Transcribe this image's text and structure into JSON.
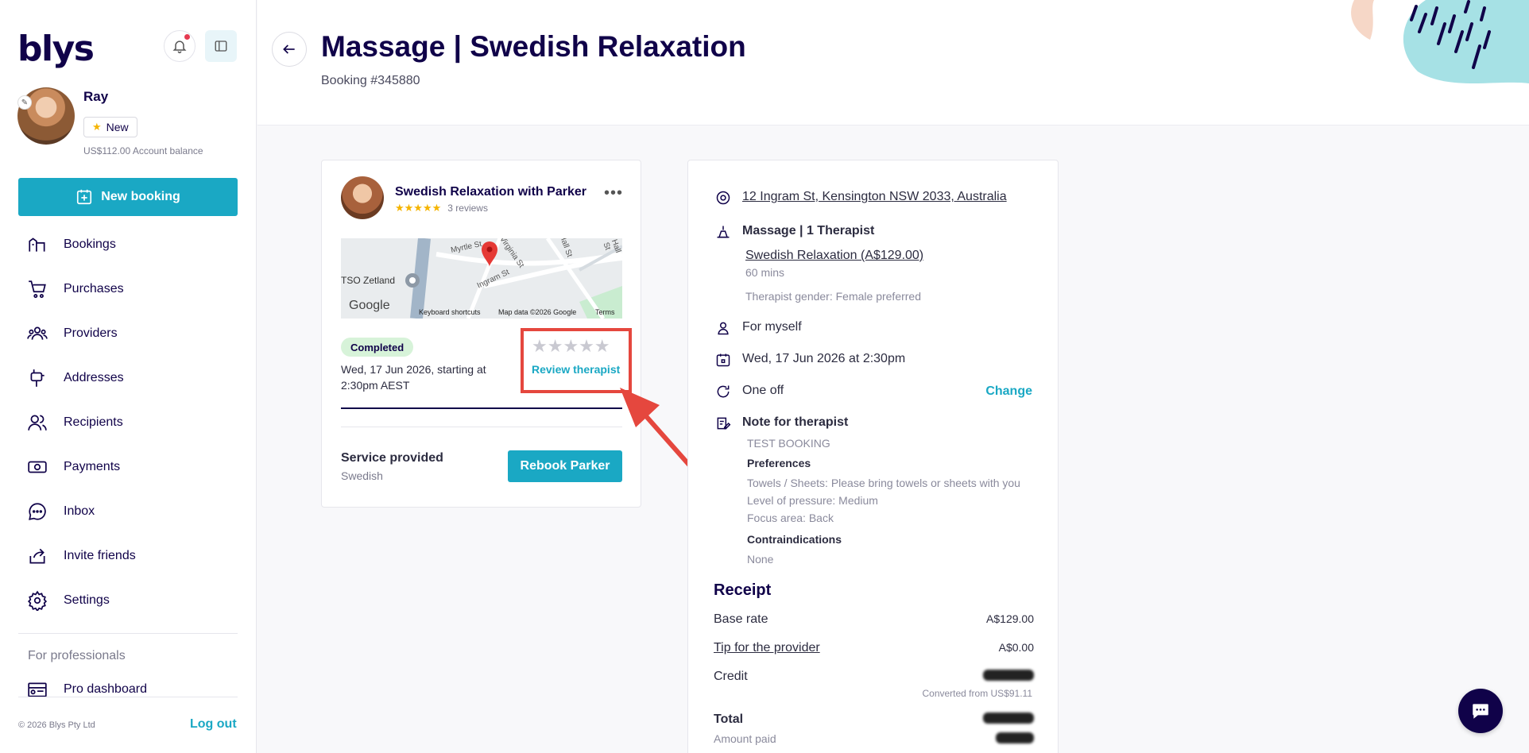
{
  "sidebar": {
    "logo": "blys",
    "user_name": "Ray",
    "badge": "New",
    "balance": "US$112.00 Account balance",
    "new_booking": "New booking",
    "nav": [
      {
        "label": "Bookings",
        "icon": "bookings-icon"
      },
      {
        "label": "Purchases",
        "icon": "cart-icon"
      },
      {
        "label": "Providers",
        "icon": "providers-icon"
      },
      {
        "label": "Addresses",
        "icon": "mailbox-icon"
      },
      {
        "label": "Recipients",
        "icon": "recipients-icon"
      },
      {
        "label": "Payments",
        "icon": "payments-icon"
      },
      {
        "label": "Inbox",
        "icon": "chat-bubble-icon"
      },
      {
        "label": "Invite friends",
        "icon": "share-icon"
      },
      {
        "label": "Settings",
        "icon": "gear-icon"
      }
    ],
    "pro_label": "For professionals",
    "pro_dashboard": "Pro dashboard",
    "copyright": "© 2026 Blys Pty Ltd",
    "logout": "Log out"
  },
  "header": {
    "title": "Massage | Swedish Relaxation",
    "booking_number": "Booking #345880"
  },
  "booking_card": {
    "title": "Swedish Relaxation with Parker",
    "stars": "★★★★★",
    "reviews": "3 reviews",
    "map": {
      "labels": [
        "Myrtle St",
        "Virginia St",
        "Ingram St",
        "TSO Zetland",
        "Hall St"
      ],
      "google": "Google",
      "shortcuts": "Keyboard shortcuts",
      "map_data": "Map data ©2026 Google",
      "terms": "Terms"
    },
    "status": "Completed",
    "date": "Wed, 17 Jun 2026, starting at 2:30pm AEST",
    "empty_stars": "★★★★★",
    "review_link": "Review therapist",
    "service_label": "Service provided",
    "service_value": "Swedish",
    "rebook": "Rebook Parker"
  },
  "details": {
    "address": "12 Ingram St, Kensington NSW 2033, Australia",
    "service_heading": "Massage | 1 Therapist",
    "service_link": "Swedish Relaxation (A$129.00)",
    "duration": "60 mins",
    "gender": "Therapist gender: Female preferred",
    "recipient": "For myself",
    "date": "Wed, 17 Jun 2026 at 2:30pm",
    "frequency": "One off",
    "change": "Change",
    "note_heading": "Note for therapist",
    "note_text": "TEST BOOKING",
    "preferences_heading": "Preferences",
    "preferences": [
      "Towels / Sheets: Please bring towels or sheets with you",
      "Level of pressure: Medium",
      "Focus area: Back"
    ],
    "contra_heading": "Contraindications",
    "contra_value": "None"
  },
  "receipt": {
    "title": "Receipt",
    "base_rate_label": "Base rate",
    "base_rate_value": "A$129.00",
    "tip_label": "Tip for the provider",
    "tip_value": "A$0.00",
    "credit_label": "Credit",
    "converted": "Converted from US$91.11",
    "total_label": "Total",
    "amount_paid_label": "Amount paid"
  },
  "colors": {
    "brand_navy": "#100249",
    "accent_teal": "#1aa8c4",
    "highlight_red": "#e5473e",
    "star_gold": "#f5b400"
  }
}
